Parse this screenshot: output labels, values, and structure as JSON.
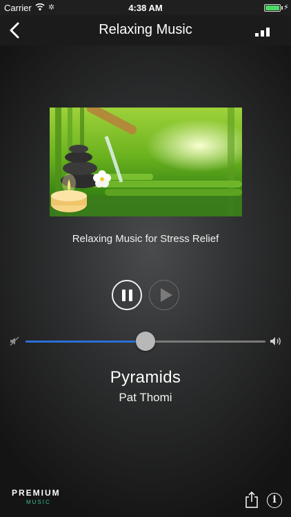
{
  "status_bar": {
    "carrier": "Carrier",
    "time": "4:38 AM",
    "battery_level": 1.0
  },
  "nav": {
    "title": "Relaxing Music",
    "back_icon": "chevron-left-icon",
    "right_icon": "signal-bars-icon"
  },
  "player": {
    "album_title": "Relaxing Music for Stress Relief",
    "state": "playing",
    "track_title": "Pyramids",
    "artist": "Pat Thomi",
    "volume": 0.5
  },
  "footer": {
    "brand_top": "PREMIUM",
    "brand_bottom": "MUSIC",
    "share_icon": "share-icon",
    "info_icon": "info-icon",
    "info_glyph": "i"
  },
  "colors": {
    "accent_blue": "#2b6fd6",
    "brand_green": "#36c28a",
    "battery_green": "#4cd964"
  }
}
